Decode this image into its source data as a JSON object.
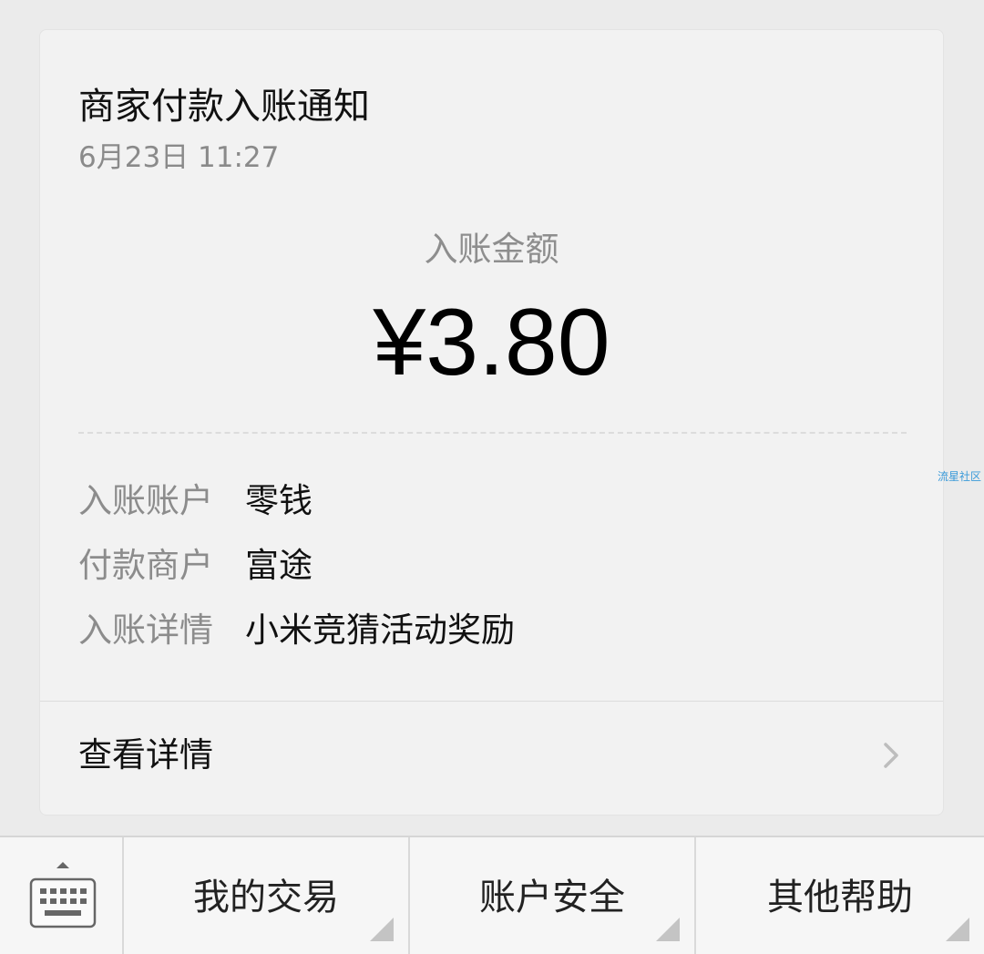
{
  "card": {
    "title": "商家付款入账通知",
    "date": "6月23日  11:27",
    "amount_label": "入账金额",
    "amount": "¥3.80",
    "rows": [
      {
        "key": "入账账户",
        "value": "零钱"
      },
      {
        "key": "付款商户",
        "value": "富途"
      },
      {
        "key": "入账详情",
        "value": "小米竞猜活动奖励"
      }
    ],
    "detail_label": "查看详情",
    "chevron_icon": "chevron-right-icon"
  },
  "watermark": "流星社区",
  "bottom_bar": {
    "keyboard_icon": "keyboard-icon",
    "menus": [
      {
        "label": "我的交易"
      },
      {
        "label": "账户安全"
      },
      {
        "label": "其他帮助"
      }
    ]
  }
}
